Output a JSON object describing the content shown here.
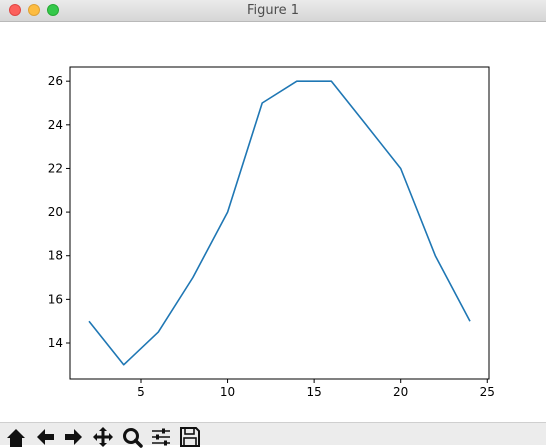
{
  "window": {
    "title": "Figure 1"
  },
  "toolbar": {
    "buttons": [
      {
        "icon": "home-icon"
      },
      {
        "icon": "back-arrow-icon"
      },
      {
        "icon": "forward-arrow-icon"
      },
      {
        "icon": "pan-icon"
      },
      {
        "icon": "zoom-icon"
      },
      {
        "icon": "subplots-config-icon"
      },
      {
        "icon": "save-icon"
      }
    ]
  },
  "chart_data": {
    "type": "line",
    "title": "",
    "xlabel": "",
    "ylabel": "",
    "x": [
      2,
      4,
      6,
      8,
      10,
      12,
      14,
      16,
      18,
      20,
      22,
      24
    ],
    "series": [
      {
        "values": [
          15,
          13,
          14.5,
          17,
          20,
          25,
          26,
          26,
          24,
          22,
          18,
          15
        ],
        "color": "#1f77b4"
      }
    ],
    "xlim": [
      0.9,
      25.1
    ],
    "ylim": [
      12.35,
      26.65
    ],
    "xticks": [
      5,
      10,
      15,
      20,
      25
    ],
    "yticks": [
      14,
      16,
      18,
      20,
      22,
      24,
      26
    ],
    "grid": false,
    "legend": false
  }
}
